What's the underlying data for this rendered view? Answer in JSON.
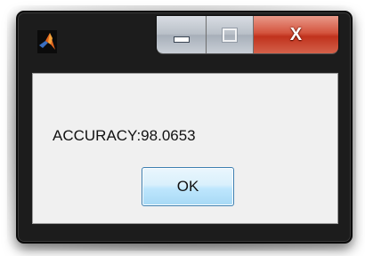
{
  "dialog": {
    "app_icon": "matlab-logo-icon",
    "caption_buttons": {
      "minimize_icon": "minimize-icon",
      "maximize_icon": "maximize-icon",
      "close_glyph": "X"
    },
    "message": "ACCURACY:98.0653",
    "ok_label": "OK"
  },
  "colors": {
    "frame": "#1c1c1c",
    "client_background": "#f0f0f0",
    "close_button": "#c0321d",
    "ok_button_border": "#3c7fb1"
  }
}
